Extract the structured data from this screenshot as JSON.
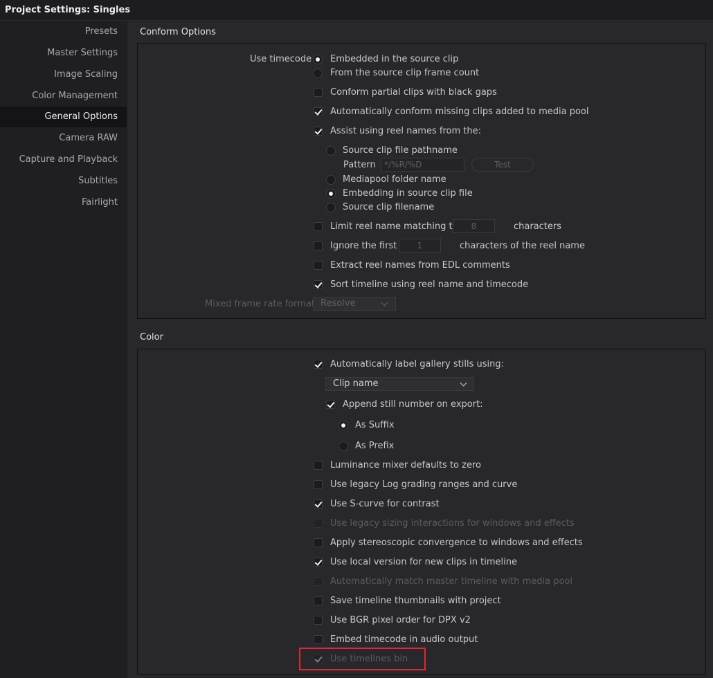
{
  "window": {
    "title": "Project Settings:  Singles"
  },
  "sidebar": {
    "items": [
      {
        "label": "Presets"
      },
      {
        "label": "Master Settings"
      },
      {
        "label": "Image Scaling"
      },
      {
        "label": "Color Management"
      },
      {
        "label": "General Options"
      },
      {
        "label": "Camera RAW"
      },
      {
        "label": "Capture and Playback"
      },
      {
        "label": "Subtitles"
      },
      {
        "label": "Fairlight"
      }
    ],
    "active": "General Options"
  },
  "conform": {
    "title": "Conform Options",
    "use_timecode_label": "Use timecode",
    "timecode_embedded": "Embedded in the source clip",
    "timecode_framecount": "From the source clip frame count",
    "conform_partial": "Conform partial clips with black gaps",
    "auto_conform_missing": "Automatically conform missing clips added to media pool",
    "assist_reel_names": "Assist using reel names from the:",
    "source_pathname": "Source clip file pathname",
    "pattern_label": "Pattern",
    "pattern_value": "*/%R/%D",
    "test_button": "Test",
    "mediapool_folder": "Mediapool folder name",
    "embedding_source": "Embedding in source clip file",
    "source_filename": "Source clip filename",
    "limit_reel": "Limit reel name matching to",
    "limit_reel_value": "8",
    "characters": "characters",
    "ignore_first": "Ignore the first",
    "ignore_first_value": "1",
    "characters_reel": "characters of the reel name",
    "extract_edl": "Extract reel names from EDL comments",
    "sort_timeline": "Sort timeline using reel name and timecode",
    "mixed_frame_label": "Mixed frame rate format",
    "mixed_frame_value": "Resolve"
  },
  "color": {
    "title": "Color",
    "auto_label_stills": "Automatically label gallery stills using:",
    "clip_name_select": "Clip name",
    "append_still": "Append still number on export:",
    "as_suffix": "As Suffix",
    "as_prefix": "As Prefix",
    "luminance_mixer": "Luminance mixer defaults to zero",
    "legacy_log": "Use legacy Log grading ranges and curve",
    "s_curve": "Use S-curve for contrast",
    "legacy_sizing": "Use legacy sizing interactions for windows and effects",
    "stereoscopic": "Apply stereoscopic convergence to windows and effects",
    "local_version": "Use local version for new clips in timeline",
    "auto_match_master": "Automatically match master timeline with media pool",
    "save_thumbnails": "Save timeline thumbnails with project",
    "bgr_pixel": "Use BGR pixel order for DPX v2",
    "embed_timecode_audio": "Embed timecode in audio output",
    "timelines_bin": "Use timelines bin"
  },
  "colors": {
    "highlight": "#e0282e",
    "active_bg": "#141416"
  }
}
